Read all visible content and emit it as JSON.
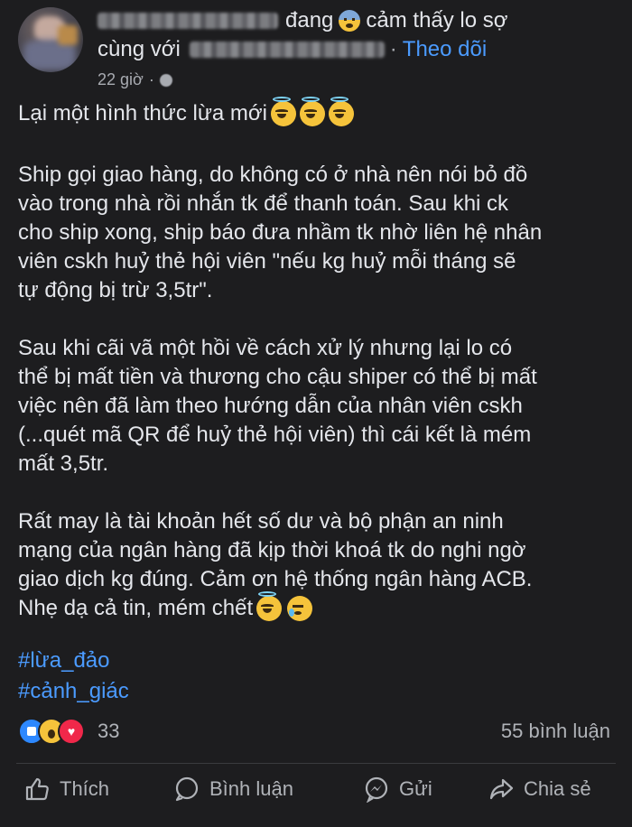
{
  "header": {
    "activity_pre": "đang",
    "feeling": "cảm thấy lo sợ",
    "line2_pre": "cùng với",
    "separator": "·",
    "follow_label": "Theo dõi",
    "time": "22 giờ",
    "time_sep": "·",
    "feeling_icon": "fearful-face-emoji",
    "privacy_icon": "globe-icon"
  },
  "post": {
    "first_line": "Lại một hình thức lừa mới",
    "first_line_emojis": [
      "smiling-face-with-halo",
      "smiling-face-with-halo",
      "smiling-face-with-halo"
    ],
    "paragraph1": "Ship gọi giao hàng, do không có ở nhà nên nói bỏ đồ\nvào trong nhà rồi nhắn tk để thanh toán. Sau khi ck\ncho ship xong, ship báo đưa nhầm tk nhờ liên hệ nhân\nviên cskh huỷ thẻ hội viên \"nếu kg huỷ mỗi tháng sẽ\ntự động bị trừ 3,5tr\".",
    "paragraph2": "Sau khi cãi vã một hồi về cách xử lý nhưng lại lo có\nthể bị mất tiền và thương cho cậu shiper có thể bị mất\nviệc nên đã làm theo hướng dẫn của nhân viên cskh\n(...quét mã QR để huỷ thẻ hội viên) thì cái kết là mém\nmất 3,5tr.",
    "paragraph3": "Rất may là tài khoản hết số dư và bộ phận an ninh\nmạng của ngân hàng đã kịp thời khoá tk do nghi ngờ\ngiao dịch kg đúng. Cảm ơn hệ thống ngân hàng ACB.",
    "last_line": "Nhẹ dạ cả tin, mém chết",
    "last_line_emojis": [
      "smiling-face-with-halo",
      "crying-face"
    ],
    "hashtags": [
      "#lừa_đảo",
      "#cảnh_giác"
    ]
  },
  "stats": {
    "reaction_icons": [
      "like",
      "wow",
      "love"
    ],
    "reaction_count": "33",
    "comment_count": "55 bình luận"
  },
  "actions": {
    "like": "Thích",
    "comment": "Bình luận",
    "send": "Gửi",
    "share": "Chia sẻ"
  },
  "colors": {
    "background": "#1d1d1f",
    "text": "#e4e6eb",
    "link": "#4b9bff",
    "muted": "#b0b3b8"
  }
}
